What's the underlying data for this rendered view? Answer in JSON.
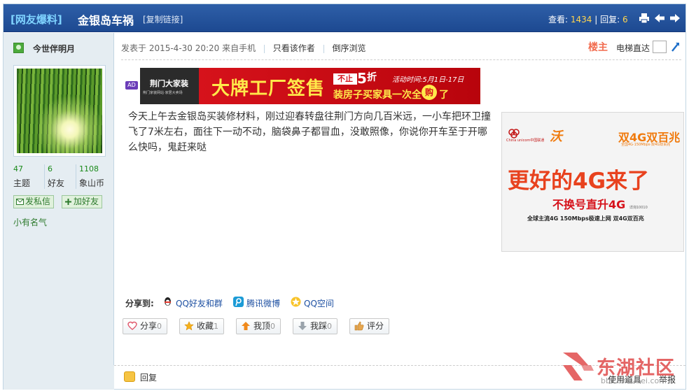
{
  "header": {
    "category": "[网友爆料]",
    "title": "金银岛车祸",
    "copy_link": "[复制链接]",
    "views_label": "查看:",
    "views": "1434",
    "replies_label": "回复:",
    "replies": "6",
    "print_icon": "print-icon",
    "prev_icon": "arrow-left-icon",
    "next_icon": "arrow-right-icon"
  },
  "author": {
    "name": "今世伴明月",
    "stats": [
      {
        "num": "47",
        "label": "主题"
      },
      {
        "num": "6",
        "label": "好友"
      },
      {
        "num": "1108",
        "label": "象山币"
      }
    ],
    "pm_label": "发私信",
    "add_friend_label": "加好友",
    "rank": "小有名气"
  },
  "post": {
    "posted_at": "发表于 2015-4-30 20:20 来自手机",
    "only_author": "只看该作者",
    "reverse": "倒序浏览",
    "floor": "楼主",
    "jump_label": "电梯直达",
    "body": "今天上午去金银岛买装修材料，刚过迎春转盘往荆门方向几百米远，一小车把环卫撞飞了7米左右，面往下一动不动，脑袋鼻子都冒血，没敢照像，你说你开车至于开哪么快吗，鬼赶来哒"
  },
  "ad_banner": {
    "tag": "AD",
    "brand": "荆门大家装",
    "brand_sub": "荆门家装网站·家居大卖场",
    "headline": "大牌工厂签售",
    "not_only": "不止",
    "five": "5",
    "zhe": "折",
    "activity": "活动时间:5月1日-17日",
    "sub": "装房子买家具一次全",
    "gou": "购",
    "le": "了"
  },
  "unicom_ad": {
    "logo_name": "China unicom中国联通",
    "wo": "沃",
    "double": "双4G双百兆",
    "double_tiny": "全国4G·150Mbps·双4G双百兆",
    "headline": "更好的4G来了",
    "sub1": "不换号直升4G",
    "sub1_small": "详询10010",
    "sub2": "全球主流4G   150Mbps极速上网   双4G双百兆"
  },
  "share": {
    "label": "分享到:",
    "items": [
      "QQ好友和群",
      "腾讯微博",
      "QQ空间"
    ]
  },
  "actions": [
    {
      "label": "分享",
      "count": "0"
    },
    {
      "label": "收藏",
      "count": "1"
    },
    {
      "label": "我顶",
      "count": "0"
    },
    {
      "label": "我踩",
      "count": "0"
    },
    {
      "label": "评分",
      "count": ""
    }
  ],
  "footer": {
    "reply": "回复",
    "tools": "使用道具",
    "report": "举报"
  },
  "watermark": {
    "name": "东湖社区",
    "url": "bbs.cnhubei.com"
  },
  "colors": {
    "header_blue": "#2e5fa8",
    "sidebar_bg": "#e5edf2",
    "floor_orange": "#f26c4f",
    "link_blue": "#1e50a2"
  }
}
